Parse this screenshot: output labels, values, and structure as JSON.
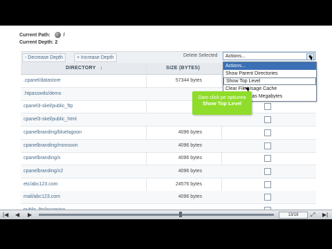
{
  "paths": {
    "current_path_label": "Current Path:",
    "current_path_value": "/",
    "current_depth_label": "Current Depth:",
    "current_depth_value": "2"
  },
  "toolbar": {
    "decrease_depth": "- Decrease Depth",
    "increase_depth": "+ Increase Depth",
    "delete_selected": "Delete Selected",
    "actions_value": "Actions..."
  },
  "table": {
    "col_directory": "Directory",
    "col_size": "Size (bytes)",
    "sort_glyph": "↓",
    "rows": [
      {
        "dir": ".cpanel/datastore",
        "size": "57344 bytes"
      },
      {
        "dir": ".htpasswds/demo",
        "size": ""
      },
      {
        "dir": "cpanel3-skel/public_ftp",
        "size": ""
      },
      {
        "dir": "cpanel3-skel/public_html",
        "size": ""
      },
      {
        "dir": "cpanelbranding/bluelagoon",
        "size": "4096 bytes"
      },
      {
        "dir": "cpanelbranding/monsoon",
        "size": "4096 bytes"
      },
      {
        "dir": "cpanelbranding/x",
        "size": "4096 bytes"
      },
      {
        "dir": "cpanelbranding/x2",
        "size": "4096 bytes"
      },
      {
        "dir": "etc/abc123.com",
        "size": "24576 bytes"
      },
      {
        "dir": "mail/abc123.com",
        "size": "4096 bytes"
      },
      {
        "dir": "public_ftp/incoming",
        "size": ""
      }
    ]
  },
  "dropdown": {
    "items": [
      "Actions...",
      "Show Parent Directories",
      "Show Top Level",
      "Clear File Usage Cache",
      "Show Sizes as Megabytes"
    ]
  },
  "tooltip": {
    "line1": "Dam click pe optiunea",
    "line2": "Show Top Level"
  },
  "player": {
    "counter": "13/18",
    "icons": [
      "previous-icon",
      "play-icon",
      "fullscreen-icon",
      "next-icon"
    ]
  },
  "colors": {
    "link": "#4a6b8a",
    "tooltip": "#8fdc2a",
    "selected": "#3b6fb6"
  }
}
